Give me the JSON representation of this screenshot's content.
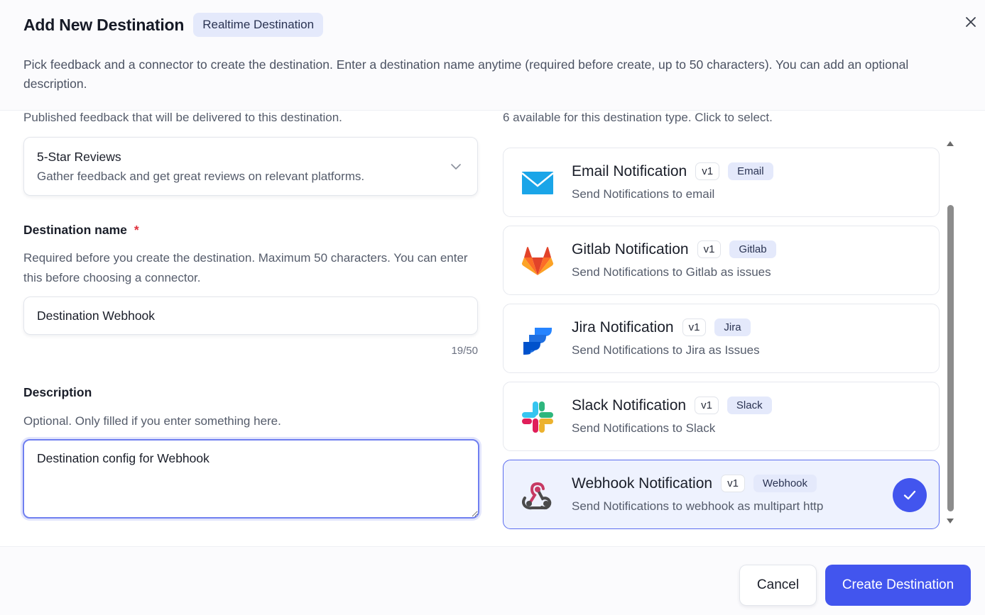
{
  "header": {
    "title": "Add New Destination",
    "type_badge": "Realtime Destination",
    "description": "Pick feedback and a connector to create the destination. Enter a destination name anytime (required before create, up to 50 characters). You can add an optional description."
  },
  "feedback": {
    "help": "Published feedback that will be delivered to this destination.",
    "selected_name": "5-Star Reviews",
    "selected_desc": "Gather feedback and get great reviews on relevant platforms."
  },
  "destination_name": {
    "label": "Destination name",
    "required_mark": "*",
    "help": "Required before you create the destination. Maximum 50 characters. You can enter this before choosing a connector.",
    "value": "Destination Webhook",
    "counter": "19/50"
  },
  "description": {
    "label": "Description",
    "help": "Optional. Only filled if you enter something here.",
    "value": "Destination config for Webhook"
  },
  "connectors": {
    "help": "6 available for this destination type. Click to select.",
    "items": [
      {
        "name": "Email Notification",
        "version": "v1",
        "tag": "Email",
        "desc": "Send Notifications to email",
        "icon": "email-icon",
        "selected": false
      },
      {
        "name": "Gitlab Notification",
        "version": "v1",
        "tag": "Gitlab",
        "desc": "Send Notifications to Gitlab as issues",
        "icon": "gitlab-icon",
        "selected": false
      },
      {
        "name": "Jira Notification",
        "version": "v1",
        "tag": "Jira",
        "desc": "Send Notifications to Jira as Issues",
        "icon": "jira-icon",
        "selected": false
      },
      {
        "name": "Slack Notification",
        "version": "v1",
        "tag": "Slack",
        "desc": "Send Notifications to Slack",
        "icon": "slack-icon",
        "selected": false
      },
      {
        "name": "Webhook Notification",
        "version": "v1",
        "tag": "Webhook",
        "desc": "Send Notifications to webhook as multipart http",
        "icon": "webhook-icon",
        "selected": true
      }
    ]
  },
  "footer": {
    "cancel_label": "Cancel",
    "create_label": "Create Destination"
  },
  "colors": {
    "primary": "#4255ee",
    "badge_bg": "#e4e9fb",
    "required": "#e0323e",
    "selected_bg": "#eef2fe"
  }
}
